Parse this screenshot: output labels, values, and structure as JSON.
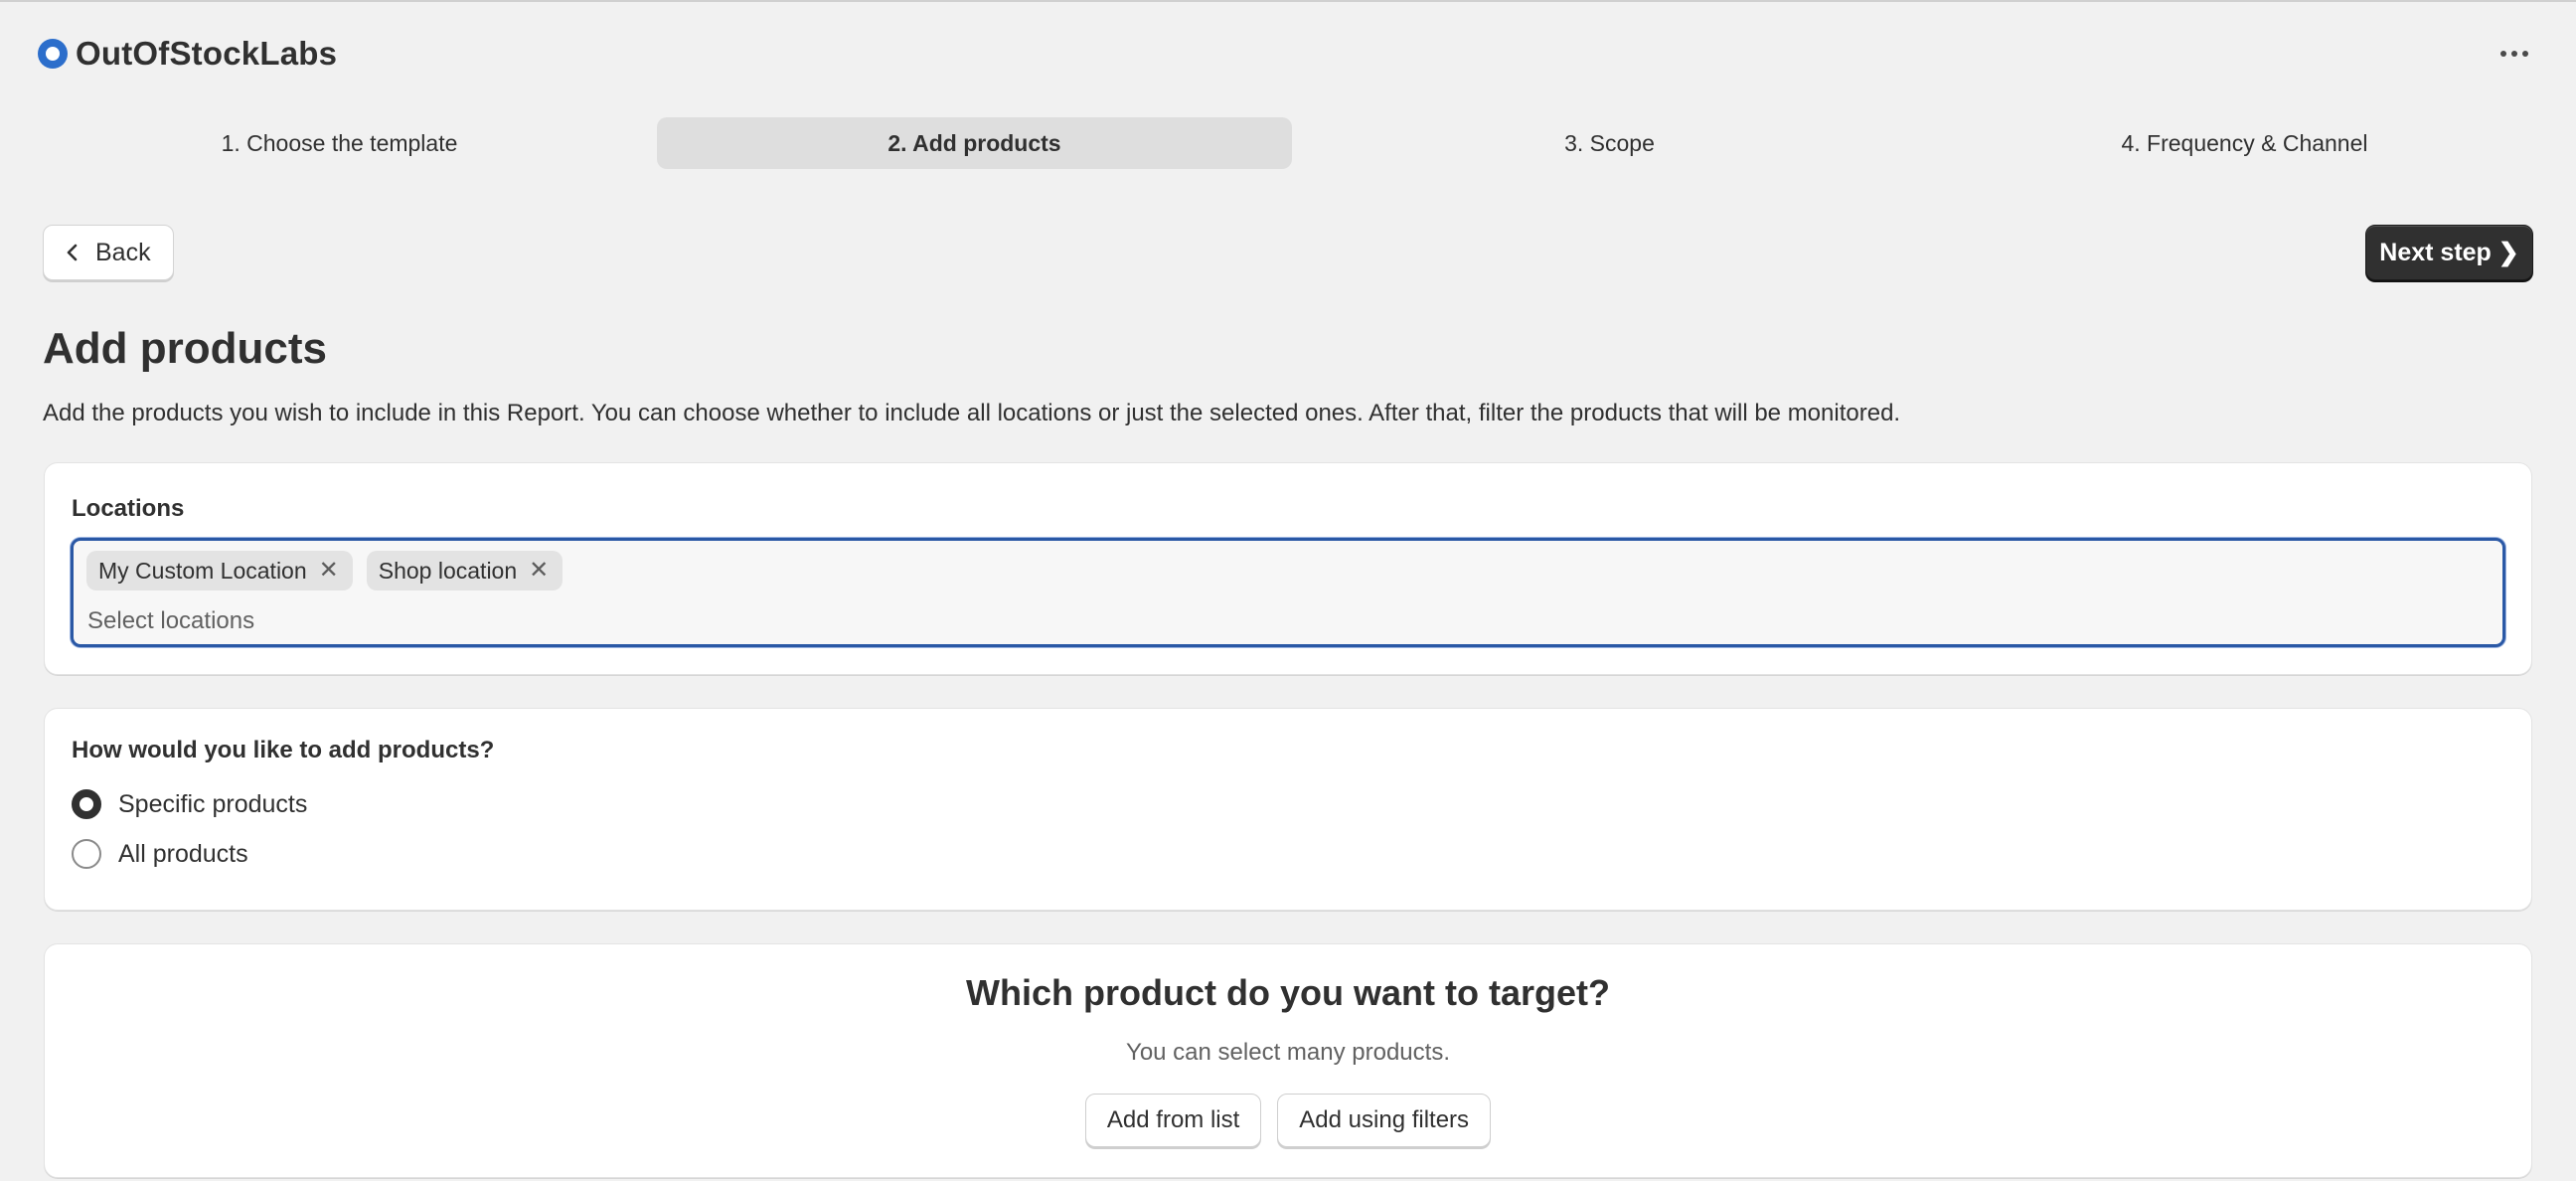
{
  "app": {
    "name": "OutOfStockLabs"
  },
  "stepper": {
    "steps": [
      {
        "label": "1. Choose the template",
        "active": false
      },
      {
        "label": "2. Add products",
        "active": true
      },
      {
        "label": "3. Scope",
        "active": false
      },
      {
        "label": "4. Frequency & Channel",
        "active": false
      }
    ]
  },
  "actions": {
    "back_label": "Back",
    "next_label": "Next step ❯"
  },
  "page": {
    "title": "Add products",
    "description": "Add the products you wish to include in this Report. You can choose whether to include all locations or just the selected ones. After that, filter the products that will be monitored."
  },
  "locations": {
    "label": "Locations",
    "selected": [
      "My Custom Location",
      "Shop location"
    ],
    "placeholder": "Select locations"
  },
  "add_method": {
    "question": "How would you like to add products?",
    "options": [
      {
        "label": "Specific products",
        "checked": true
      },
      {
        "label": "All products",
        "checked": false
      }
    ]
  },
  "target": {
    "title": "Which product do you want to target?",
    "subtitle": "You can select many products.",
    "add_from_list_label": "Add from list",
    "add_using_filters_label": "Add using filters"
  },
  "colors": {
    "primary_button": "#303030",
    "focus_ring": "#2a58a5",
    "active_step": "#dedede"
  }
}
